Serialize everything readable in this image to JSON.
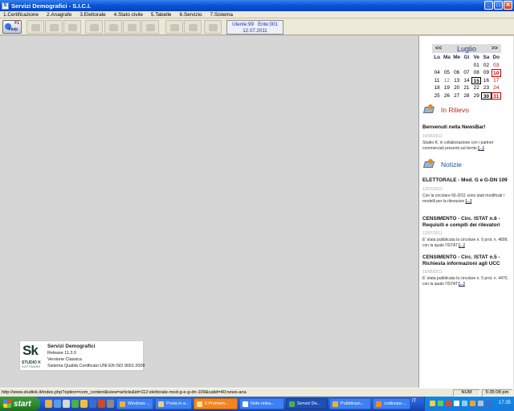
{
  "window": {
    "title": "Servizi Demografici - S.I.C.I.",
    "icon": "sk-app-icon"
  },
  "menu": [
    "1.Certificazione",
    "2.Anagrafe",
    "3.Elettorale",
    "4.Stato civile",
    "5.Tabelle",
    "6.Servizio",
    "7.Sistema"
  ],
  "toolbar": {
    "help_key": "F1",
    "help_label": "Help",
    "user_line": "Utente:99   Ente:001",
    "date_line": "12.07.2011"
  },
  "about": {
    "logo_sk": "Sk",
    "logo_studio": "STUDIO K",
    "logo_software": "SOFTWARE",
    "product": "Servizi Demografici",
    "release": "Release 11.3.0",
    "version": "Versione Classica",
    "cert": "Sistema Qualità Certificato UNI EN ISO 9001:2008"
  },
  "calendar": {
    "prev": "<<",
    "next": ">>",
    "month": "Luglio",
    "weekdays": [
      "Lu",
      "Ma",
      "Me",
      "Gi",
      "Ve",
      "Sa",
      "Do"
    ],
    "weeks": [
      [
        "",
        "",
        "",
        "",
        "01",
        "02",
        "03"
      ],
      [
        "04",
        "05",
        "06",
        "07",
        "08",
        "09",
        "10"
      ],
      [
        "11",
        "12",
        "13",
        "14",
        "15",
        "16",
        "17"
      ],
      [
        "18",
        "19",
        "20",
        "21",
        "22",
        "23",
        "24"
      ],
      [
        "25",
        "26",
        "27",
        "28",
        "29",
        "30",
        "31"
      ]
    ]
  },
  "rilievo": {
    "title": "In Rilievo",
    "items": [
      {
        "headline": "Benvenuti nella NewsBar!",
        "date": "16/06/2011",
        "body": "Studio K, in collaborazione con i partner commerciali presenti sul territo",
        "more": "[...]"
      }
    ]
  },
  "notizie": {
    "title": "Notizie",
    "items": [
      {
        "headline": "ELETTORALE - Mod. G e G-DN 109",
        "date": "12/07/2011",
        "body": "Con la circolare 66-2011 sono stati modificati i modelli per la rilevazion",
        "more": "[...]"
      },
      {
        "headline": "CENSIMENTO - Circ. ISTAT n.6 - Requisiti e compiti dei rilevatori",
        "date": "12/07/2011",
        "body": "E' stata pubblicata la circolare n. 6 prot. n. 4899, con la quale l'ISTAT",
        "more": "[...]"
      },
      {
        "headline": "CENSIMENTO - Circ. ISTAT n.5 - Richiesta informazioni agli UCC",
        "date": "16/06/2011",
        "body": "E' stata pubblicata la circolare n. 5 prot. n. 4470, con la quale l'ISTAT",
        "more": "[...]"
      }
    ]
  },
  "statusbar": {
    "url": "http://www.studiok.it/index.php?option=com_content&view=article&id=112:elettorale-mod-g-e-g-dn-109&catid=40:news-ana",
    "num": "NUM",
    "time": "5:35:08 pm"
  },
  "taskbar": {
    "start": "start",
    "tasks": [
      {
        "label": "Windows ...",
        "color": "#3c81f3",
        "icon": "windows-explorer-icon"
      },
      {
        "label": "Posta in a...",
        "color": "#3c81f3",
        "icon": "mail-icon"
      },
      {
        "label": "5 Promem...",
        "color": "#f2851e",
        "icon": "reminder-icon"
      },
      {
        "label": "Note relea...",
        "color": "#3c81f3",
        "icon": "notes-icon"
      },
      {
        "label": "Servizi De...",
        "color": "#1e4fb4",
        "icon": "app-icon"
      },
      {
        "label": "Pubblicazi...",
        "color": "#3c81f3",
        "icon": "publication-icon"
      },
      {
        "label": "codicepa-...",
        "color": "#3c81f3",
        "icon": "browser-icon"
      }
    ],
    "lang": "IT",
    "clock": "17.35"
  }
}
